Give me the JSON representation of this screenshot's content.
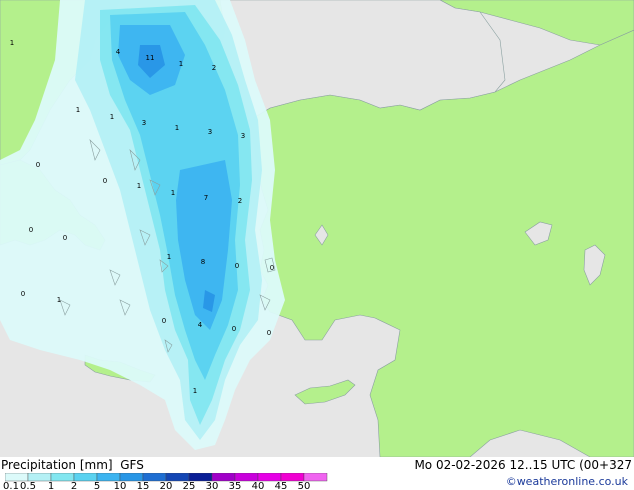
{
  "title": {
    "variable": "Precipitation [mm]",
    "model": "GFS",
    "valid_time": "Mo 02-02-2026 12..15 UTC (00+327"
  },
  "credit": "©weatheronline.co.uk",
  "legend": {
    "ticks": [
      "0.1",
      "0.5",
      "1",
      "2",
      "5",
      "10",
      "15",
      "20",
      "25",
      "30",
      "35",
      "40",
      "45",
      "50"
    ],
    "colors": [
      "#dcfafa",
      "#b4f0f5",
      "#82e6f0",
      "#5ad2f0",
      "#3cb4f0",
      "#2896e6",
      "#1e6ed2",
      "#1446b4",
      "#0a1e96",
      "#a000c8",
      "#c800dc",
      "#e600e6",
      "#f000d2",
      "#f064f0"
    ]
  },
  "map": {
    "land_color": "#b4f08c",
    "sea_color": "#e6e6e6",
    "values": [
      "4",
      "11",
      "1",
      "2",
      "1",
      "1",
      "3",
      "1",
      "3",
      "3",
      "1",
      "0",
      "0",
      "1",
      "7",
      "2",
      "1",
      "0",
      "0",
      "0",
      "1",
      "8",
      "0",
      "0",
      "1",
      "0",
      "4",
      "0",
      "0",
      "1"
    ]
  }
}
